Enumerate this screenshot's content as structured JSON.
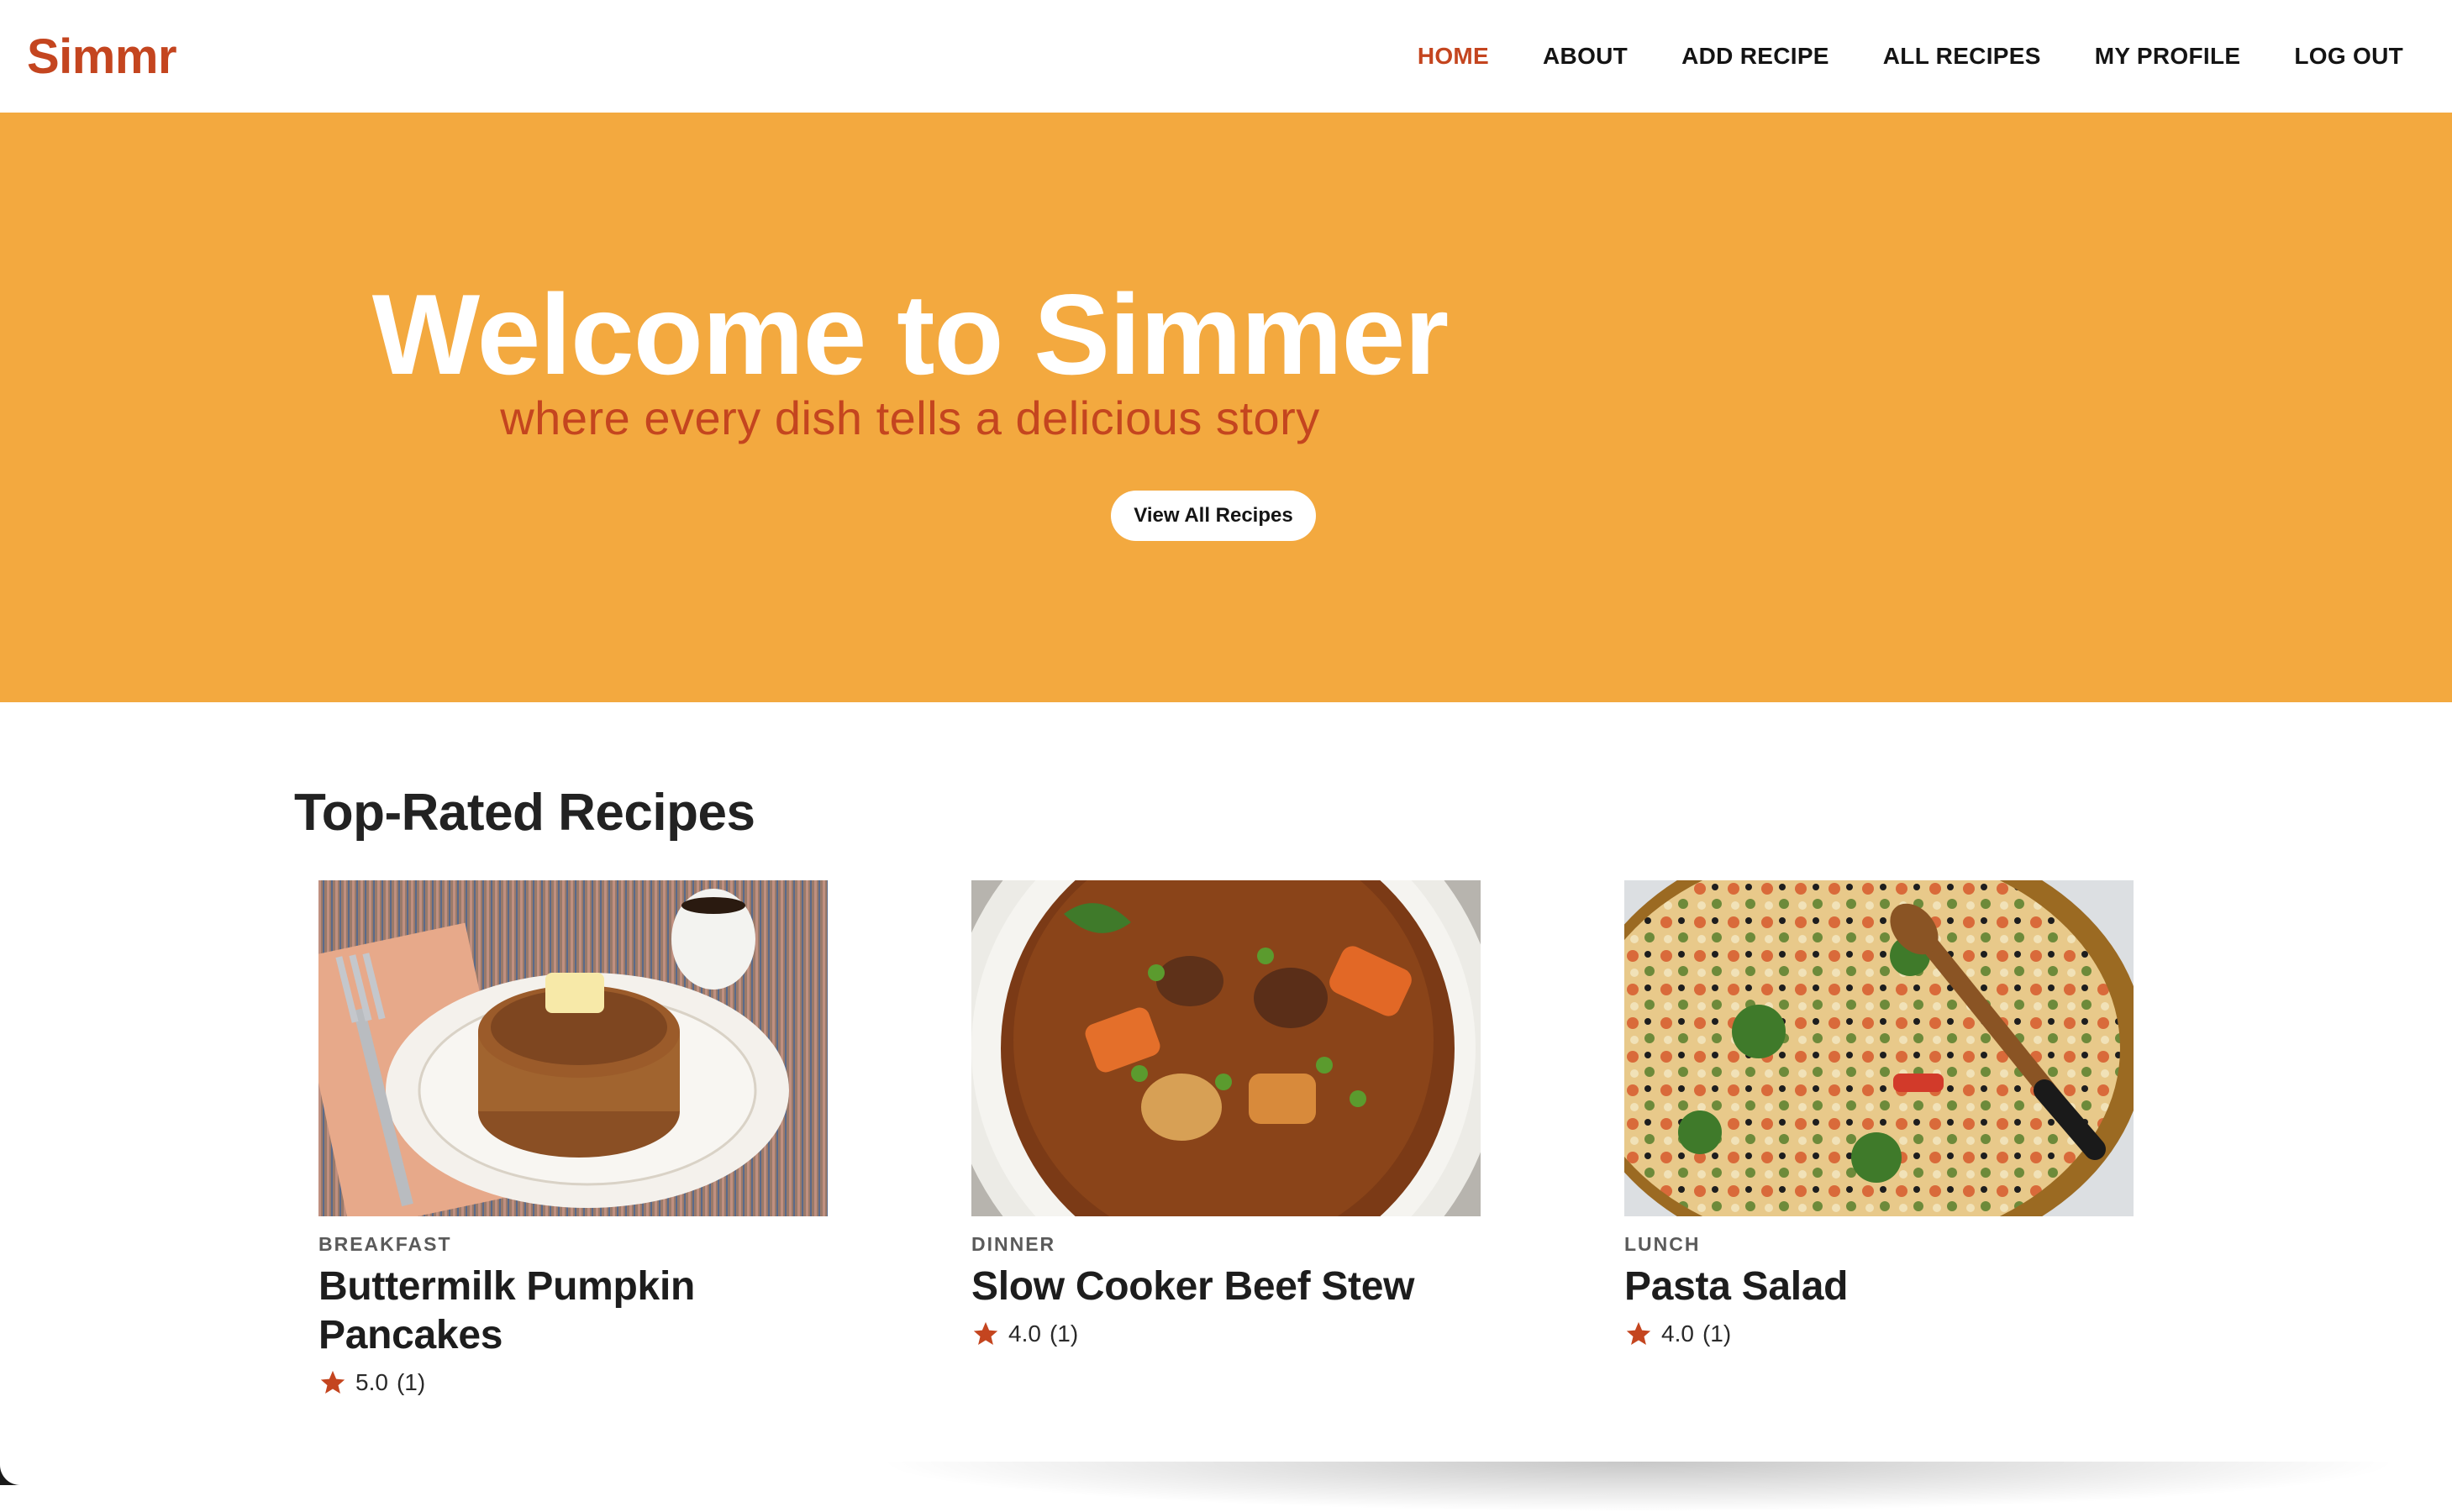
{
  "nav": {
    "brand": "Simmr",
    "links": [
      {
        "label": "HOME",
        "active": true
      },
      {
        "label": "ABOUT"
      },
      {
        "label": "ADD RECIPE"
      },
      {
        "label": "ALL RECIPES"
      },
      {
        "label": "MY PROFILE"
      },
      {
        "label": "LOG OUT"
      }
    ]
  },
  "hero": {
    "title": "Welcome to Simmer",
    "subtitle": "where every dish tells a delicious story",
    "button_label": "View All Recipes"
  },
  "section": {
    "title": "Top-Rated Recipes"
  },
  "recipes": [
    {
      "category": "BREAKFAST",
      "title": "Buttermilk Pumpkin Pancakes",
      "rating": "5.0",
      "count": "(1)",
      "image": "pancakes-photo"
    },
    {
      "category": "DINNER",
      "title": "Slow Cooker Beef Stew",
      "rating": "4.0",
      "count": "(1)",
      "image": "beef-stew-photo"
    },
    {
      "category": "LUNCH",
      "title": "Pasta Salad",
      "rating": "4.0",
      "count": "(1)",
      "image": "pasta-salad-photo"
    }
  ],
  "colors": {
    "accent": "#c4451f",
    "hero_bg": "#f3a93f",
    "text": "#1d1d1d"
  },
  "icons": {
    "star": "star-icon"
  }
}
